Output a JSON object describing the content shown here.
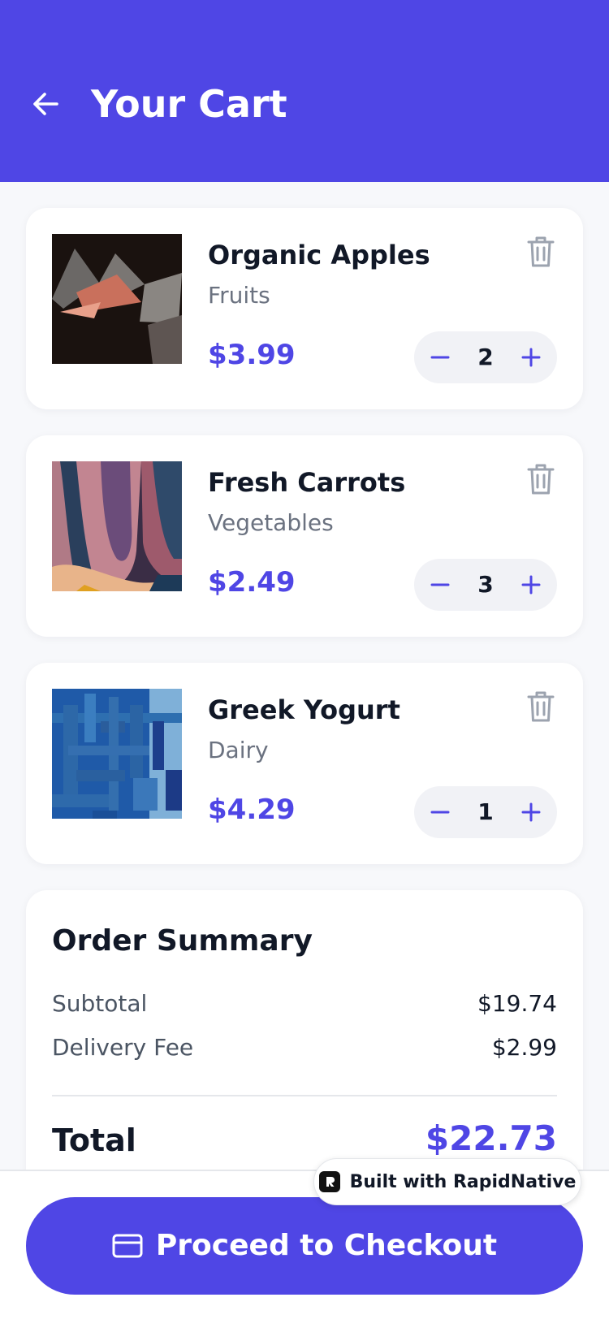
{
  "header": {
    "title": "Your Cart",
    "background": "#4f46e5"
  },
  "cart": {
    "items": [
      {
        "name": "Organic Apples",
        "category": "Fruits",
        "price": "$3.99",
        "quantity": "2"
      },
      {
        "name": "Fresh Carrots",
        "category": "Vegetables",
        "price": "$2.49",
        "quantity": "3"
      },
      {
        "name": "Greek Yogurt",
        "category": "Dairy",
        "price": "$4.29",
        "quantity": "1"
      }
    ]
  },
  "summary": {
    "title": "Order Summary",
    "subtotal_label": "Subtotal",
    "subtotal_value": "$19.74",
    "delivery_label": "Delivery Fee",
    "delivery_value": "$2.99",
    "total_label": "Total",
    "total_value": "$22.73"
  },
  "checkout": {
    "label": "Proceed to Checkout"
  },
  "badge": {
    "label": "Built with RapidNative"
  },
  "colors": {
    "accent": "#4f46e5",
    "muted": "#6b7280",
    "text": "#111827",
    "stepper_bg": "#f1f2f6"
  },
  "icons": {
    "back": "arrow-left-icon",
    "delete": "trash-icon",
    "decrement": "minus-icon",
    "increment": "plus-icon",
    "checkout": "credit-card-icon",
    "badge": "rapidnative-logo-icon"
  }
}
